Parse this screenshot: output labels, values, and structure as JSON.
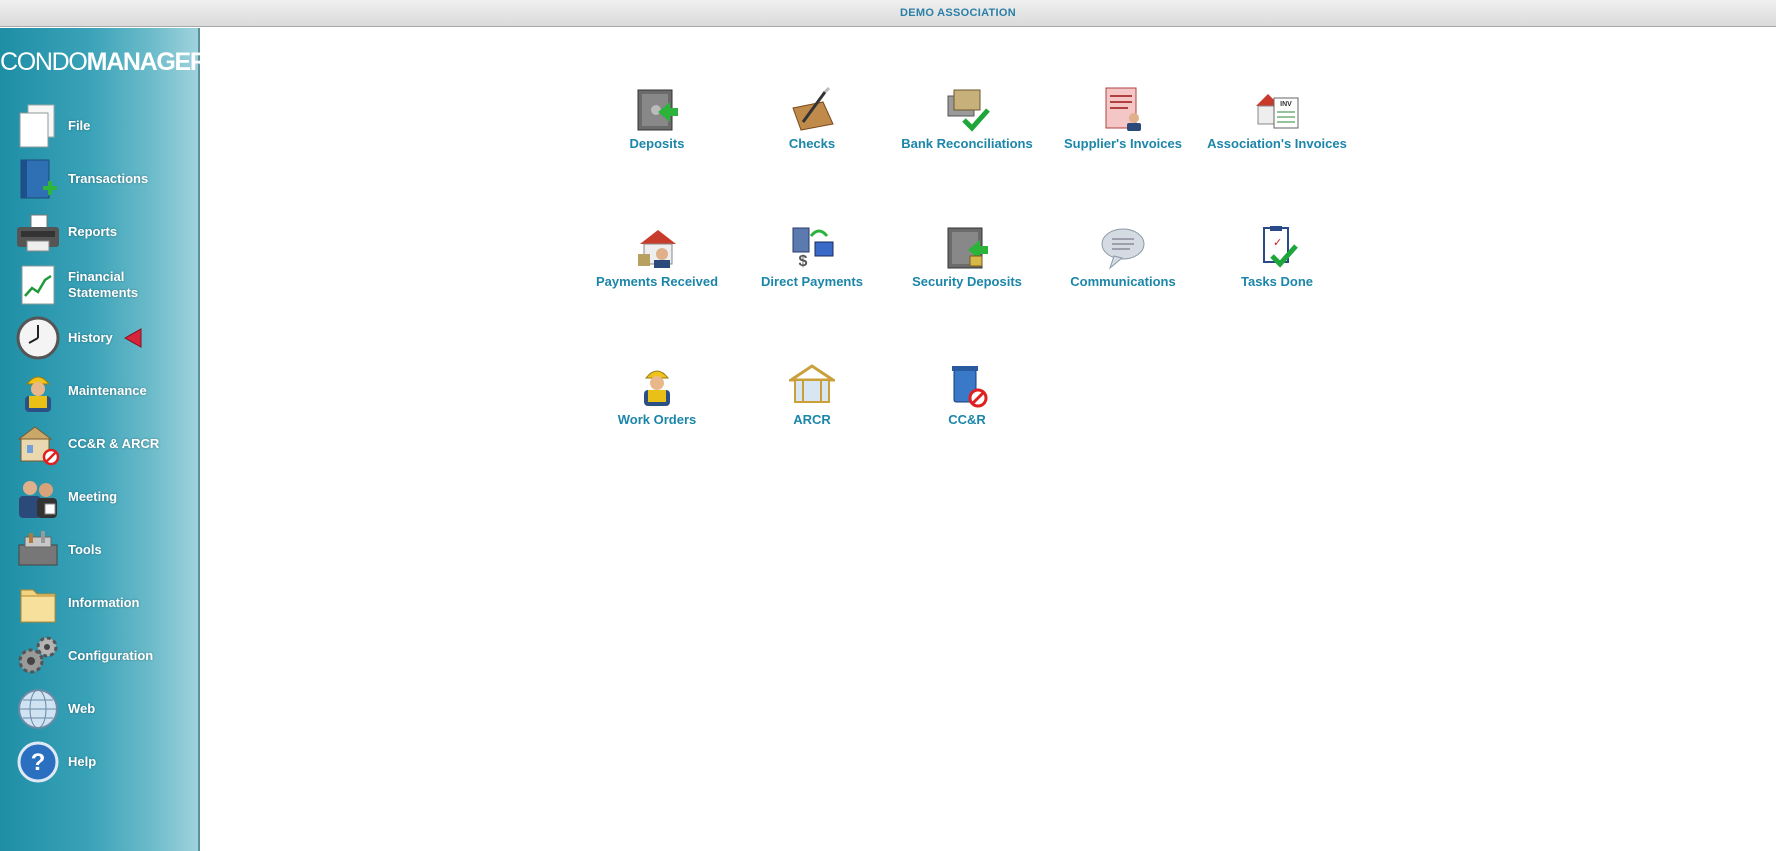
{
  "window": {
    "title": "DEMO ASSOCIATION"
  },
  "brand": {
    "part1": "CONDO",
    "part2": "MANAGER"
  },
  "sidebar": {
    "items": [
      {
        "label": "File",
        "icon": "file-icon"
      },
      {
        "label": "Transactions",
        "icon": "transactions-book-icon"
      },
      {
        "label": "Reports",
        "icon": "printer-icon"
      },
      {
        "label": "Financial Statements",
        "icon": "chart-icon"
      },
      {
        "label": "History",
        "icon": "clock-icon",
        "indicator": "red-arrow-icon"
      },
      {
        "label": "Maintenance",
        "icon": "worker-icon"
      },
      {
        "label": "CC&R & ARCR",
        "icon": "building-prohibited-icon"
      },
      {
        "label": "Meeting",
        "icon": "meeting-people-icon"
      },
      {
        "label": "Tools",
        "icon": "toolbox-icon"
      },
      {
        "label": "Information",
        "icon": "folder-icon"
      },
      {
        "label": "Configuration",
        "icon": "gears-icon"
      },
      {
        "label": "Web",
        "icon": "globe-icon"
      },
      {
        "label": "Help",
        "icon": "help-icon"
      }
    ]
  },
  "main": {
    "tiles": [
      {
        "label": "Deposits",
        "icon": "safe-deposit-icon"
      },
      {
        "label": "Checks",
        "icon": "check-pen-icon"
      },
      {
        "label": "Bank Reconciliations",
        "icon": "bank-reconciliation-icon"
      },
      {
        "label": "Supplier's Invoices",
        "icon": "supplier-invoice-icon"
      },
      {
        "label": "Association's Invoices",
        "icon": "association-invoice-icon"
      },
      {
        "label": "Payments Received",
        "icon": "payments-received-icon"
      },
      {
        "label": "Direct Payments",
        "icon": "direct-payments-icon"
      },
      {
        "label": "Security Deposits",
        "icon": "security-deposit-icon"
      },
      {
        "label": "Communications",
        "icon": "speech-bubble-icon"
      },
      {
        "label": "Tasks Done",
        "icon": "clipboard-check-icon"
      },
      {
        "label": "Work Orders",
        "icon": "work-order-worker-icon"
      },
      {
        "label": "ARCR",
        "icon": "house-frame-icon"
      },
      {
        "label": "CC&R",
        "icon": "trash-prohibited-icon"
      }
    ]
  },
  "colors": {
    "accent": "#1b86aa",
    "sidebar": "#2a98ae",
    "history_arrow": "#d6243a"
  }
}
